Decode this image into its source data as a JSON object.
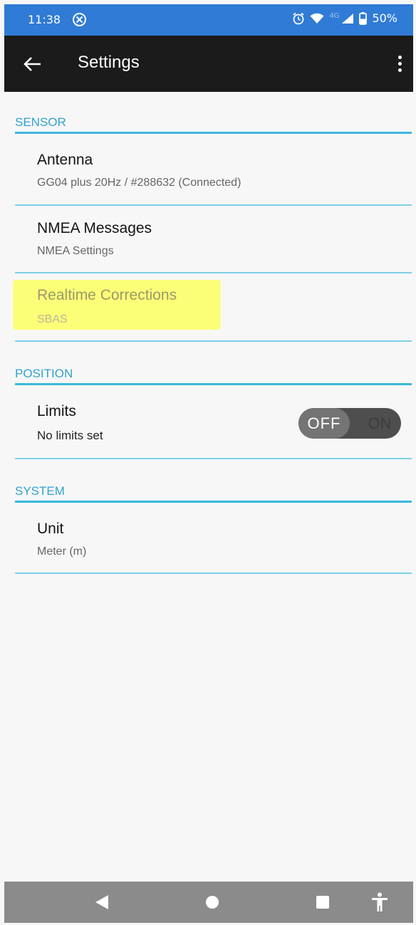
{
  "status_bar": {
    "time": "11:38",
    "network_label": "4G",
    "battery": "50%",
    "icons": [
      "cancel-icon",
      "alarm-icon",
      "wifi-icon",
      "signal-icon",
      "battery-icon"
    ]
  },
  "app_bar": {
    "title": "Settings",
    "icons": [
      "back-arrow-icon",
      "overflow-menu-icon"
    ]
  },
  "sections": {
    "sensor": {
      "header": "SENSOR",
      "antenna": {
        "title": "Antenna",
        "summary": "GG04 plus 20Hz / #288632 (Connected)"
      },
      "nmea": {
        "title": "NMEA Messages",
        "summary": "NMEA Settings"
      },
      "corrections": {
        "title": "Realtime Corrections",
        "summary": "SBAS"
      }
    },
    "position": {
      "header": "POSITION",
      "limits": {
        "title": "Limits",
        "summary": "No limits set",
        "toggle_off_label": "OFF",
        "toggle_on_label": "ON",
        "enabled": false
      }
    },
    "system": {
      "header": "SYSTEM",
      "unit": {
        "title": "Unit",
        "summary": "Meter (m)"
      }
    }
  },
  "nav_bar": {
    "icons": [
      "back-triangle-icon",
      "home-circle-icon",
      "recents-square-icon",
      "accessibility-icon"
    ]
  },
  "colors": {
    "status_bar": "#2f7bd6",
    "app_bar": "#1b1b1b",
    "accent": "#3ab7dd",
    "highlight": "#fbff78",
    "nav_bar": "#8b8b8b"
  }
}
